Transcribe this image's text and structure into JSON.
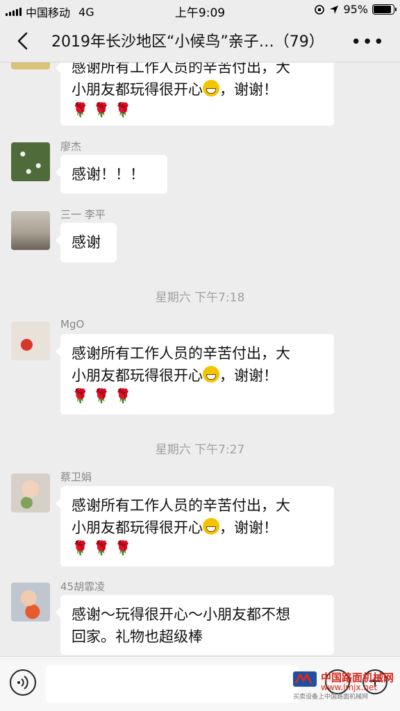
{
  "status_bar": {
    "carrier": "中国移动",
    "network": "4G",
    "time": "上午9:09",
    "battery_percent": "95%",
    "battery_level": 0.95
  },
  "nav": {
    "title": "2019年长沙地区“小候鸟”亲子…（79）",
    "back_icon": "chevron-left-icon",
    "more_icon": "more-icon"
  },
  "messages": [
    {
      "sender": "",
      "text_line1": "感谢所有工作人员的辛苦付出，大",
      "text_line2a": "小朋友都玩得很开心",
      "text_line2b": "，谢谢！",
      "emoji": "grin-emoji",
      "roses": "🌹🌹🌹"
    },
    {
      "sender": "廖杰",
      "text": "感谢！！！"
    },
    {
      "sender": "三一 李平",
      "text": "感谢"
    },
    {
      "sender": "MgO",
      "text_line1": "感谢所有工作人员的辛苦付出，大",
      "text_line2a": "小朋友都玩得很开心",
      "text_line2b": "，谢谢！",
      "emoji": "grin-emoji",
      "roses": "🌹🌹🌹"
    },
    {
      "sender": "蔡卫娟",
      "text_line1": "感谢所有工作人员的辛苦付出，大",
      "text_line2a": "小朋友都玩得很开心",
      "text_line2b": "，谢谢！",
      "emoji": "grin-emoji",
      "roses": "🌹🌹🌹"
    },
    {
      "sender": "45胡霏凌",
      "text_line1": "感谢～玩得很开心～小朋友都不想",
      "text_line2": "回家。礼物也超级棒"
    }
  ],
  "timestamps": [
    "星期六 下午7:18",
    "星期六 下午7:27"
  ],
  "input_bar": {
    "voice_icon": "voice-icon",
    "emoji_icon": "emoji-icon",
    "plus_icon": "plus-icon",
    "placeholder": ""
  },
  "watermark": {
    "title": "中国路面机械网",
    "url": "www.lmjx.net",
    "tagline": "买卖设备上中国路面机械网"
  },
  "colors": {
    "background": "#ededed",
    "bubble": "#ffffff",
    "timestamp": "#a0a0a0",
    "watermark": "#d52b1e"
  }
}
